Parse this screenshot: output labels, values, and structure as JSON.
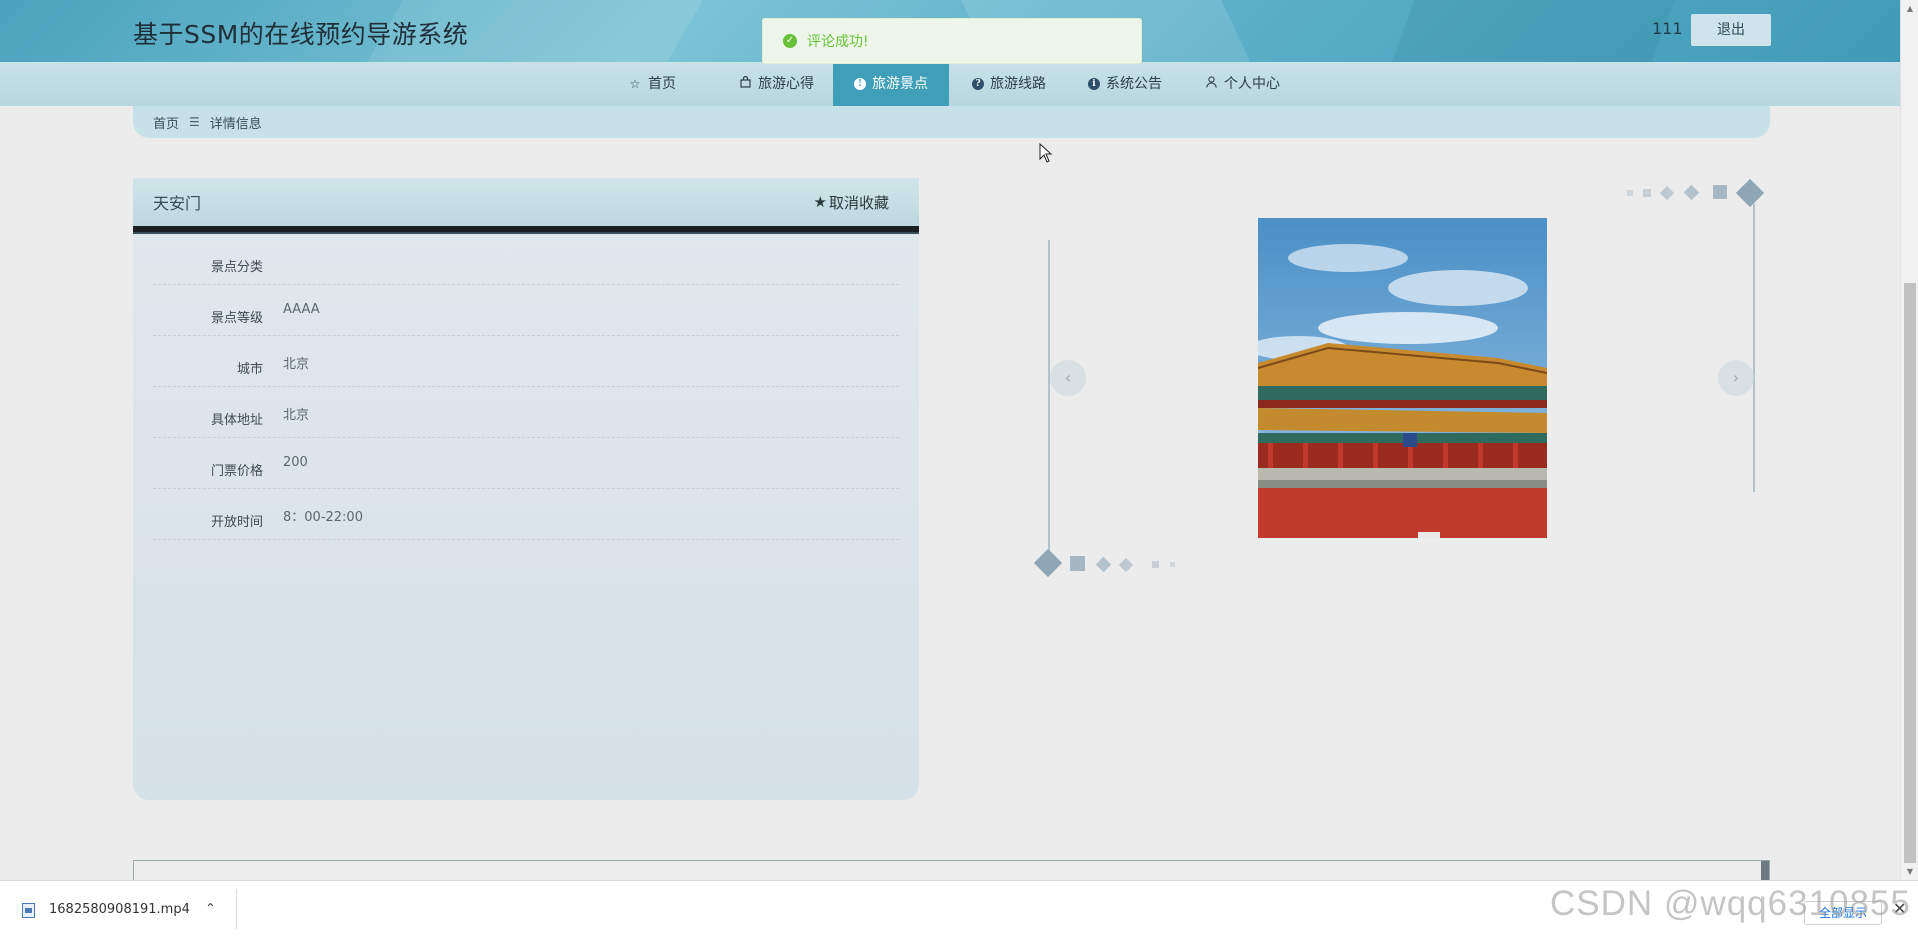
{
  "header": {
    "site_title": "基于SSM的在线预约导游系统",
    "user_name": "111",
    "logout_label": "退出"
  },
  "nav": {
    "items": [
      {
        "label": "首页",
        "icon": "star-outline-icon",
        "active": false
      },
      {
        "label": "旅游心得",
        "icon": "bag-icon",
        "active": false
      },
      {
        "label": "旅游景点",
        "icon": "exclamation-circle-icon",
        "active": true
      },
      {
        "label": "旅游线路",
        "icon": "question-circle-icon",
        "active": false
      },
      {
        "label": "系统公告",
        "icon": "info-circle-icon",
        "active": false
      },
      {
        "label": "个人中心",
        "icon": "user-icon",
        "active": false
      }
    ]
  },
  "toast": {
    "message": "评论成功!",
    "icon": "check-circle-icon",
    "color": "#67c23a"
  },
  "breadcrumb": {
    "home": "首页",
    "separator": "☰",
    "current": "详情信息"
  },
  "detail": {
    "title": "天安门",
    "favorite_label": "取消收藏",
    "fields": [
      {
        "label": "景点分类",
        "value": ""
      },
      {
        "label": "景点等级",
        "value": "AAAA"
      },
      {
        "label": "城市",
        "value": "北京"
      },
      {
        "label": "具体地址",
        "value": "北京"
      },
      {
        "label": "门票价格",
        "value": "200"
      },
      {
        "label": "开放时间",
        "value": "8：00-22:00"
      }
    ]
  },
  "carousel": {
    "prev_label": "‹",
    "next_label": "›"
  },
  "download_bar": {
    "file_name": "1682580908191.mp4",
    "show_all_label": "全部显示",
    "close_label": "✕"
  },
  "watermark": "CSDN @wqq6310855",
  "theme": {
    "accent": "#3f9fb8",
    "header": "#5fb2ca",
    "nav_bg": "#c7e2e8"
  }
}
